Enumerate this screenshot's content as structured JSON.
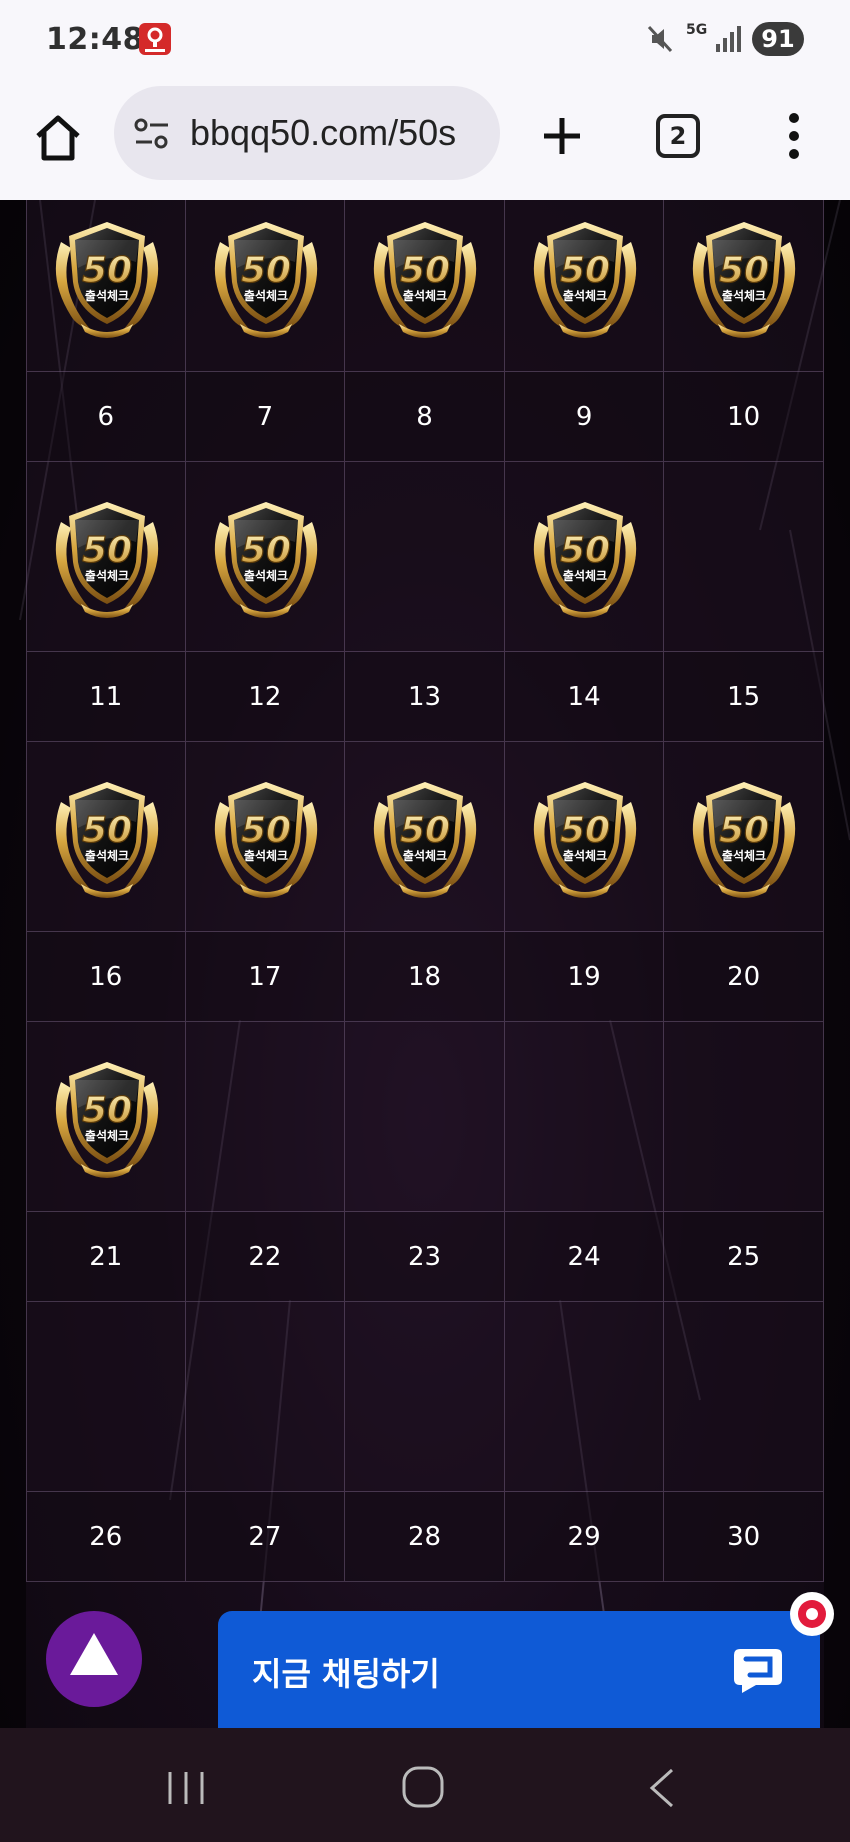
{
  "status_bar": {
    "time": "12:48",
    "network": "5G",
    "battery": "91",
    "icons": [
      "app-badge-icon",
      "mute-icon",
      "signal-icon"
    ]
  },
  "browser": {
    "url": "bbqq50.com/50s",
    "tab_count": "2",
    "icons": [
      "home-icon",
      "site-info-icon",
      "plus-icon",
      "more-vert-icon"
    ]
  },
  "calendar": {
    "badge_text": "출석체크",
    "badge_number": "50",
    "rows": [
      {
        "days": [
          "6",
          "7",
          "8",
          "9",
          "10"
        ],
        "checked_above": [
          true,
          true,
          true,
          true,
          true
        ]
      },
      {
        "days": [
          "11",
          "12",
          "13",
          "14",
          "15"
        ],
        "checked_above": [
          true,
          true,
          false,
          true,
          false
        ]
      },
      {
        "days": [
          "16",
          "17",
          "18",
          "19",
          "20"
        ],
        "checked_above": [
          true,
          true,
          true,
          true,
          true
        ]
      },
      {
        "days": [
          "21",
          "22",
          "23",
          "24",
          "25"
        ],
        "checked_above": [
          true,
          false,
          false,
          false,
          false
        ]
      },
      {
        "days": [
          "26",
          "27",
          "28",
          "29",
          "30"
        ],
        "checked_above": [
          false,
          false,
          false,
          false,
          false
        ]
      }
    ]
  },
  "chat": {
    "label": "지금 채팅하기"
  },
  "colors": {
    "chat_blue": "#0f5ad6",
    "top_button_purple": "#6a1a9a",
    "badge_gold": "#d7a640"
  }
}
